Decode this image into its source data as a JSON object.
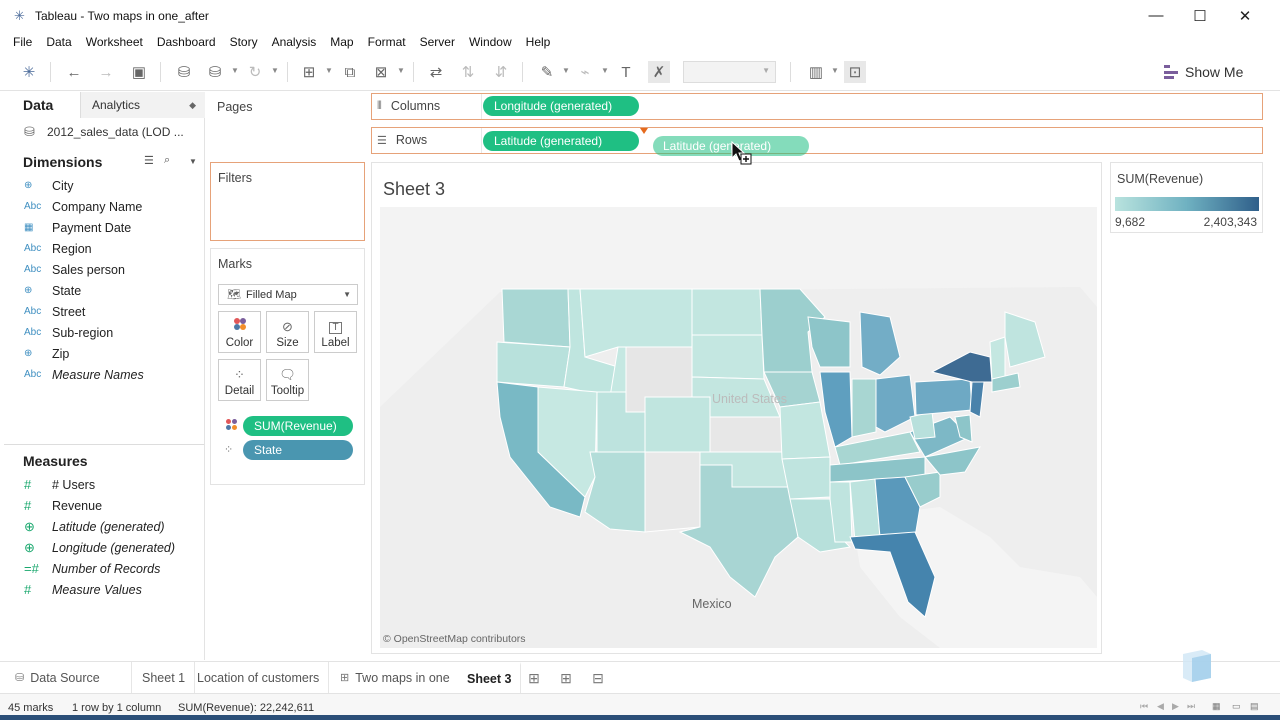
{
  "window": {
    "title": "Tableau - Two maps in one_after",
    "controls": {
      "minimize": "—",
      "maximize": "☐",
      "close": "✕"
    }
  },
  "menu": [
    "File",
    "Data",
    "Worksheet",
    "Dashboard",
    "Story",
    "Analysis",
    "Map",
    "Format",
    "Server",
    "Window",
    "Help"
  ],
  "toolbar": {
    "show_me_label": "Show Me"
  },
  "data_pane": {
    "tab_data": "Data",
    "tab_analytics": "Analytics",
    "datasource": "2012_sales_data (LOD ...",
    "dimensions_title": "Dimensions",
    "dimensions": [
      {
        "type": "geo",
        "icon": "⊕",
        "name": "City",
        "italic": false
      },
      {
        "type": "abc",
        "icon": "Abc",
        "name": "Company Name",
        "italic": false
      },
      {
        "type": "date",
        "icon": "▦",
        "name": "Payment Date",
        "italic": false
      },
      {
        "type": "abc",
        "icon": "Abc",
        "name": "Region",
        "italic": false
      },
      {
        "type": "abc",
        "icon": "Abc",
        "name": "Sales person",
        "italic": false
      },
      {
        "type": "geo",
        "icon": "⊕",
        "name": "State",
        "italic": false
      },
      {
        "type": "abc",
        "icon": "Abc",
        "name": "Street",
        "italic": false
      },
      {
        "type": "abc",
        "icon": "Abc",
        "name": "Sub-region",
        "italic": false
      },
      {
        "type": "geo",
        "icon": "⊕",
        "name": "Zip",
        "italic": false
      },
      {
        "type": "abc",
        "icon": "Abc",
        "name": "Measure Names",
        "italic": true
      }
    ],
    "measures_title": "Measures",
    "measures": [
      {
        "icon": "#",
        "name": "# Users",
        "italic": false
      },
      {
        "icon": "#",
        "name": "Revenue",
        "italic": false
      },
      {
        "icon": "⊕",
        "name": "Latitude (generated)",
        "italic": true
      },
      {
        "icon": "⊕",
        "name": "Longitude (generated)",
        "italic": true
      },
      {
        "icon": "=#",
        "name": "Number of Records",
        "italic": true
      },
      {
        "icon": "#",
        "name": "Measure Values",
        "italic": true
      }
    ]
  },
  "cards": {
    "pages_title": "Pages",
    "filters_title": "Filters",
    "marks_title": "Marks",
    "mark_type": "Filled Map",
    "buttons": {
      "color": "Color",
      "size": "Size",
      "label": "Label",
      "detail": "Detail",
      "tooltip": "Tooltip"
    },
    "pills": {
      "color_pill": "SUM(Revenue)",
      "detail_pill": "State"
    }
  },
  "shelves": {
    "columns_label": "Columns",
    "columns_pill": "Longitude (generated)",
    "rows_label": "Rows",
    "rows_pill": "Latitude (generated)",
    "dragging_pill": "Latitude (generated)"
  },
  "view": {
    "sheet_title": "Sheet 3",
    "map_labels": {
      "country": "United States",
      "mexico": "Mexico"
    },
    "attribution": "© OpenStreetMap contributors"
  },
  "legend": {
    "title": "SUM(Revenue)",
    "min": "9,682",
    "max": "2,403,343"
  },
  "sheet_tabs": {
    "data_source": "Data Source",
    "tabs": [
      "Sheet 1",
      "Location of customers",
      "Two maps in one",
      "Sheet 3"
    ],
    "active": "Sheet 3"
  },
  "status": {
    "marks": "45 marks",
    "shape": "1 row by 1 column",
    "sum": "SUM(Revenue): 22,242,611"
  },
  "colors": {
    "pill_green": "#1fbf83",
    "pill_blue": "#4a96b0",
    "ramp_low": "#b9e3de",
    "ramp_high": "#2f5f8a",
    "shelf_border": "#e6a279"
  }
}
